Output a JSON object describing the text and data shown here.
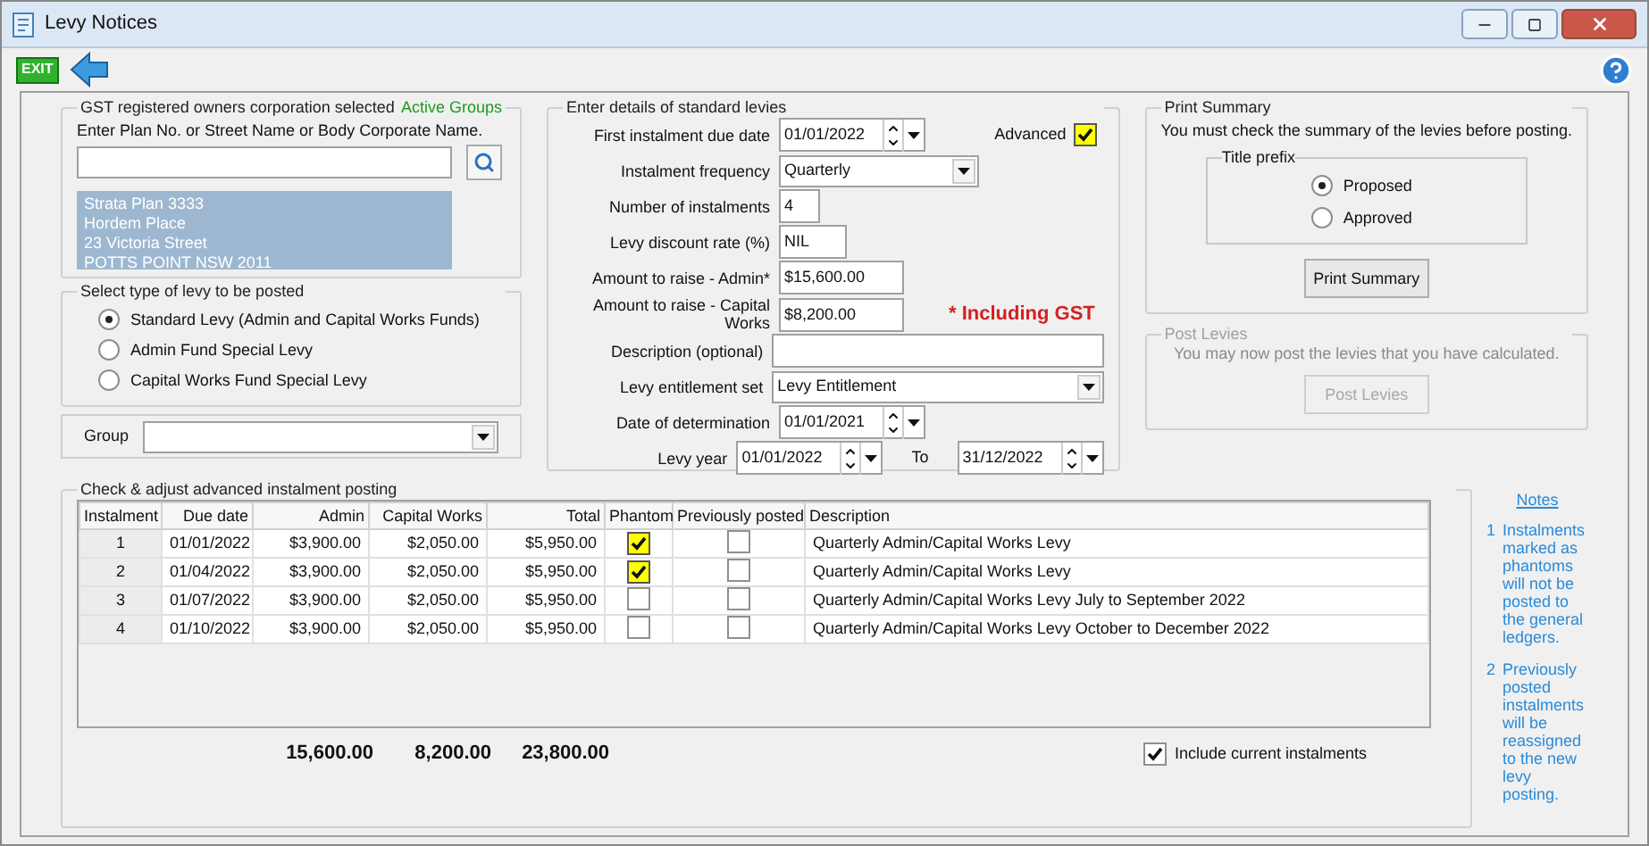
{
  "window": {
    "title": "Levy Notices"
  },
  "toolbar": {
    "exit_label": "EXIT"
  },
  "owners": {
    "title": "GST registered owners corporation selected",
    "link": "Active Groups",
    "search_label": "Enter Plan No. or Street Name or Body Corporate Name.",
    "address_lines": [
      "Strata Plan 3333",
      "Hordem Place",
      "23 Victoria Street",
      "POTTS POINT  NSW  2011"
    ]
  },
  "levy_type": {
    "title": "Select type of levy to be posted",
    "options": [
      {
        "label": "Standard Levy (Admin and Capital Works Funds)",
        "selected": true
      },
      {
        "label": "Admin Fund Special Levy",
        "selected": false
      },
      {
        "label": "Capital Works Fund Special Levy",
        "selected": false
      }
    ]
  },
  "group": {
    "label": "Group"
  },
  "details": {
    "title": "Enter details of standard levies",
    "advanced": {
      "label": "Advanced",
      "checked": true
    },
    "fields": [
      {
        "kind": "date",
        "label": "First instalment due date",
        "value": "01/01/2022"
      },
      {
        "kind": "select",
        "label": "Instalment frequency",
        "value": "Quarterly"
      },
      {
        "kind": "number",
        "label": "Number of instalments",
        "value": "4"
      },
      {
        "kind": "rate",
        "label": "Levy discount rate (%)",
        "value": "NIL"
      },
      {
        "kind": "amount",
        "label": "Amount to raise - Admin*",
        "value": "$15,600.00"
      },
      {
        "kind": "amount",
        "label": "Amount to raise - Capital Works",
        "value": "$8,200.00",
        "note": "* Including GST"
      },
      {
        "kind": "wide",
        "label": "Description (optional)"
      },
      {
        "kind": "wideselect",
        "label": "Levy entitlement set",
        "value": "Levy Entitlement"
      },
      {
        "kind": "date",
        "label": "Date of determination",
        "value": "01/01/2021"
      },
      {
        "kind": "daterange",
        "label": "Levy year",
        "value": "01/01/2022",
        "to_label": "To",
        "to_value": "31/12/2022"
      }
    ]
  },
  "print_summary": {
    "title": "Print Summary",
    "message": "You must check the summary of the levies before posting.",
    "prefix": {
      "title": "Title prefix",
      "options": [
        {
          "label": "Proposed",
          "selected": true
        },
        {
          "label": "Approved",
          "selected": false
        }
      ]
    },
    "button": "Print Summary"
  },
  "post_levies": {
    "title": "Post Levies",
    "message": "You may now post the levies that you have calculated.",
    "button": "Post Levies",
    "disabled": true
  },
  "instalments": {
    "title": "Check & adjust advanced instalment posting",
    "columns": [
      "Instalment",
      "Due date",
      "Admin",
      "Capital Works",
      "Total",
      "Phantom",
      "Previously posted",
      "Description"
    ],
    "rows": [
      {
        "instalment": "1",
        "due_date": "01/01/2022",
        "admin": "$3,900.00",
        "capital_works": "$2,050.00",
        "total": "$5,950.00",
        "phantom": true,
        "previously_posted": false,
        "description": "Quarterly Admin/Capital Works Levy"
      },
      {
        "instalment": "2",
        "due_date": "01/04/2022",
        "admin": "$3,900.00",
        "capital_works": "$2,050.00",
        "total": "$5,950.00",
        "phantom": true,
        "previously_posted": false,
        "description": "Quarterly Admin/Capital Works Levy"
      },
      {
        "instalment": "3",
        "due_date": "01/07/2022",
        "admin": "$3,900.00",
        "capital_works": "$2,050.00",
        "total": "$5,950.00",
        "phantom": false,
        "previously_posted": false,
        "description": "Quarterly Admin/Capital Works Levy July to September 2022"
      },
      {
        "instalment": "4",
        "due_date": "01/10/2022",
        "admin": "$3,900.00",
        "capital_works": "$2,050.00",
        "total": "$5,950.00",
        "phantom": false,
        "previously_posted": false,
        "description": "Quarterly Admin/Capital Works Levy October to December 2022"
      }
    ],
    "totals": {
      "admin": "15,600.00",
      "capital_works": "8,200.00",
      "total": "23,800.00"
    },
    "include_current": {
      "label": "Include current instalments",
      "checked": true
    }
  },
  "notes": {
    "title": "Notes",
    "items": [
      {
        "number": "1",
        "text": "Instalments marked as phantoms will not be posted to the general ledgers."
      },
      {
        "number": "2",
        "text": "Previously posted instalments will be reassigned to the new levy posting."
      }
    ]
  }
}
